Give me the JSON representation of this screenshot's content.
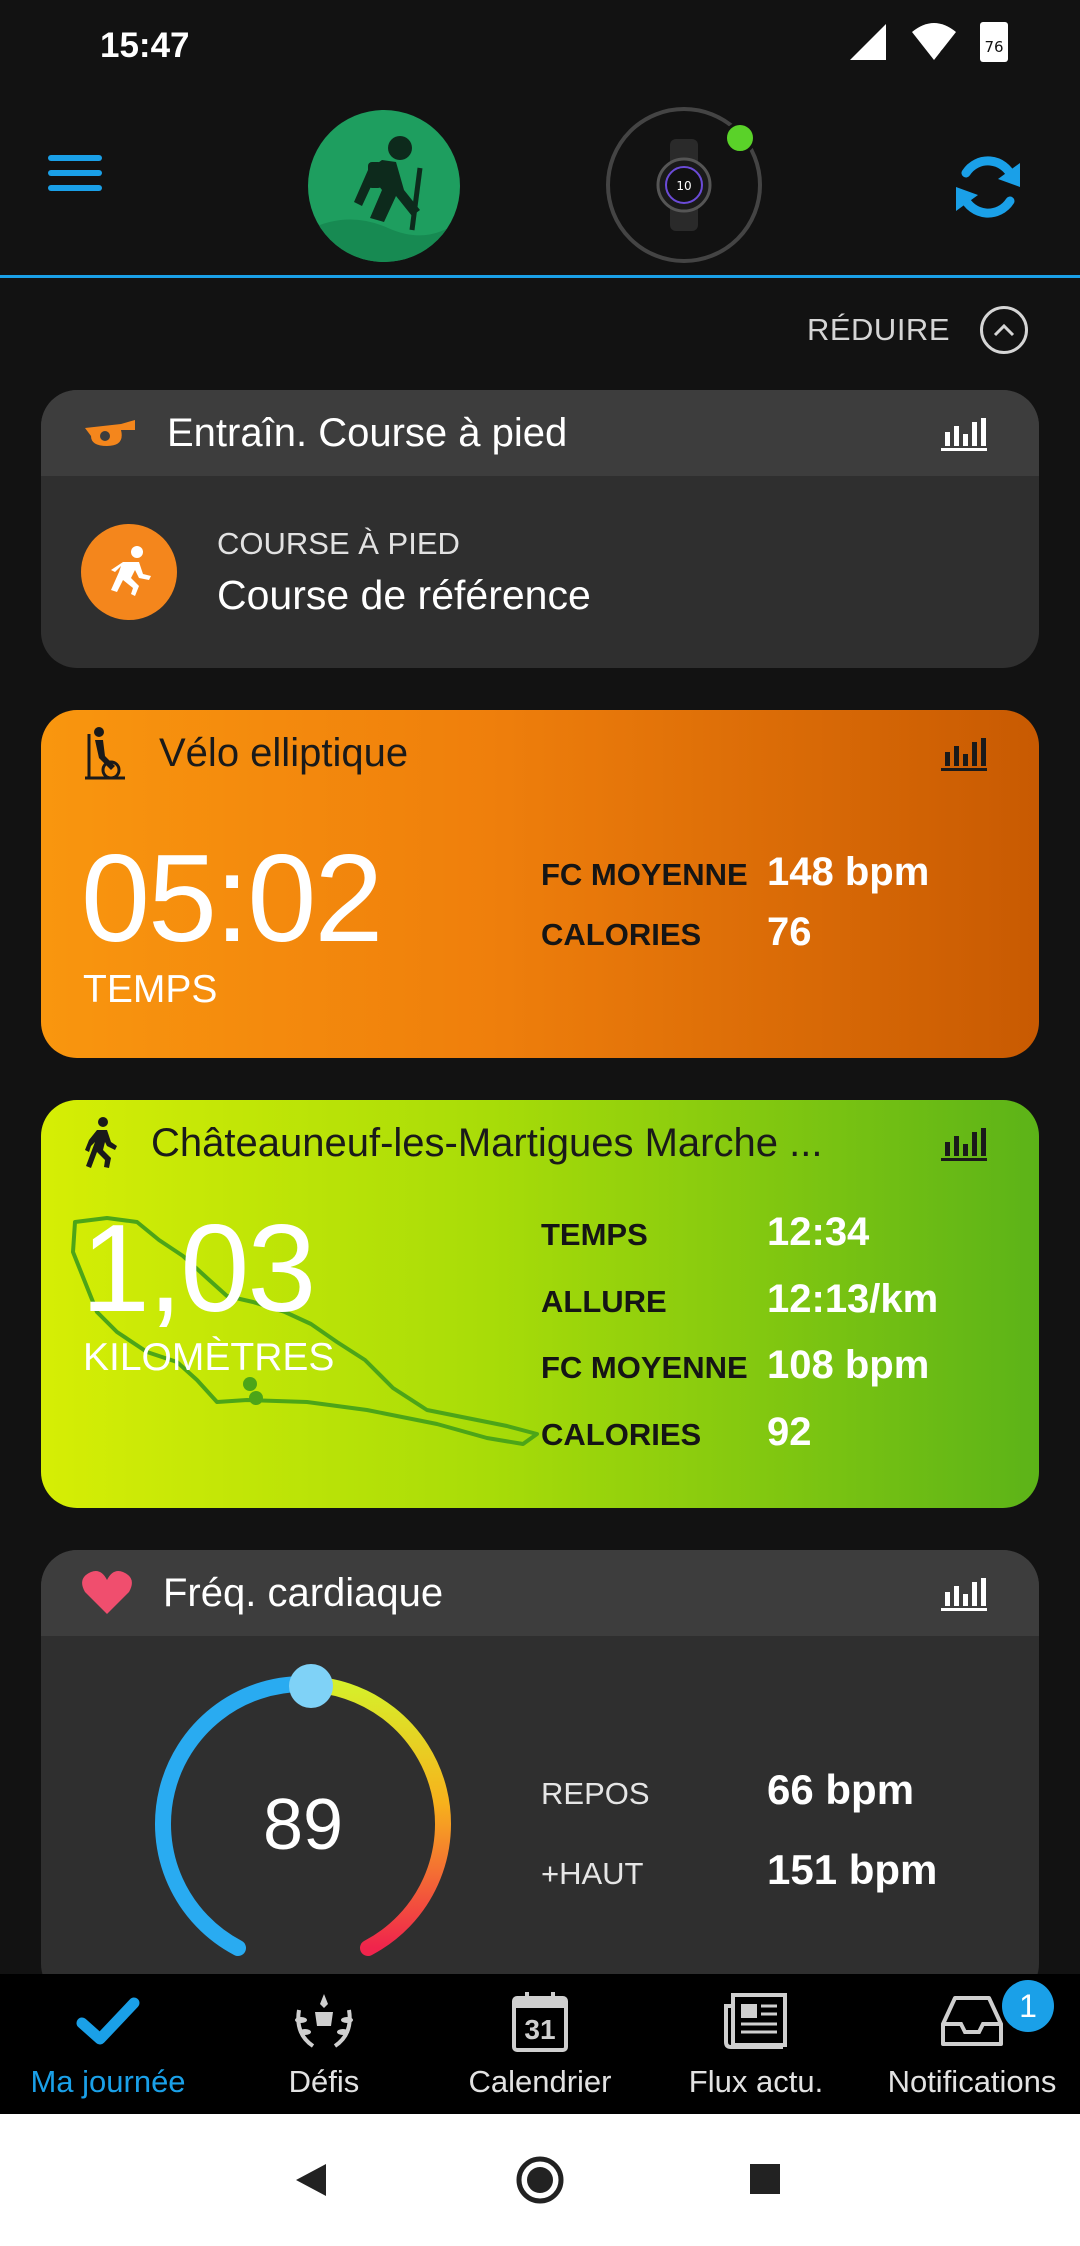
{
  "status_bar": {
    "time": "15:47",
    "battery": "76"
  },
  "header": {
    "menu_icon": "hamburger-menu-icon",
    "avatar_icon": "hiker-icon",
    "device_icon": "smartwatch-icon",
    "sync_icon": "sync-icon",
    "accent_color": "#1aa0e8",
    "device_status_color": "#5ad229"
  },
  "collapse": {
    "label": "RÉDUIRE"
  },
  "workout_card": {
    "title": "Entraîn. Course à pied",
    "category": "COURSE À PIED",
    "name": "Course de référence"
  },
  "elliptical_card": {
    "title": "Vélo elliptique",
    "big_value": "05:02",
    "big_label": "TEMPS",
    "stats": [
      {
        "label": "FC MOYENNE",
        "value": "148 bpm"
      },
      {
        "label": "CALORIES",
        "value": "76"
      }
    ]
  },
  "walk_card": {
    "title": "Châteauneuf-les-Martigues Marche ...",
    "big_value": "1,03",
    "big_label": "KILOMÈTRES",
    "stats": [
      {
        "label": "TEMPS",
        "value": "12:34"
      },
      {
        "label": "ALLURE",
        "value": "12:13/km"
      },
      {
        "label": "FC MOYENNE",
        "value": "108 bpm"
      },
      {
        "label": "CALORIES",
        "value": "92"
      }
    ]
  },
  "heart_card": {
    "title": "Fréq. cardiaque",
    "current": "89",
    "stats": [
      {
        "label": "REPOS",
        "value": "66 bpm"
      },
      {
        "label": "+HAUT",
        "value": "151 bpm"
      }
    ]
  },
  "bottom_nav": [
    {
      "label": "Ma journée",
      "icon": "checkmark-icon",
      "active": true
    },
    {
      "label": "Défis",
      "icon": "laurel-icon"
    },
    {
      "label": "Calendrier",
      "icon": "calendar-icon",
      "day": "31"
    },
    {
      "label": "Flux actu.",
      "icon": "newsfeed-icon"
    },
    {
      "label": "Notifications",
      "icon": "inbox-icon",
      "badge": "1"
    }
  ]
}
